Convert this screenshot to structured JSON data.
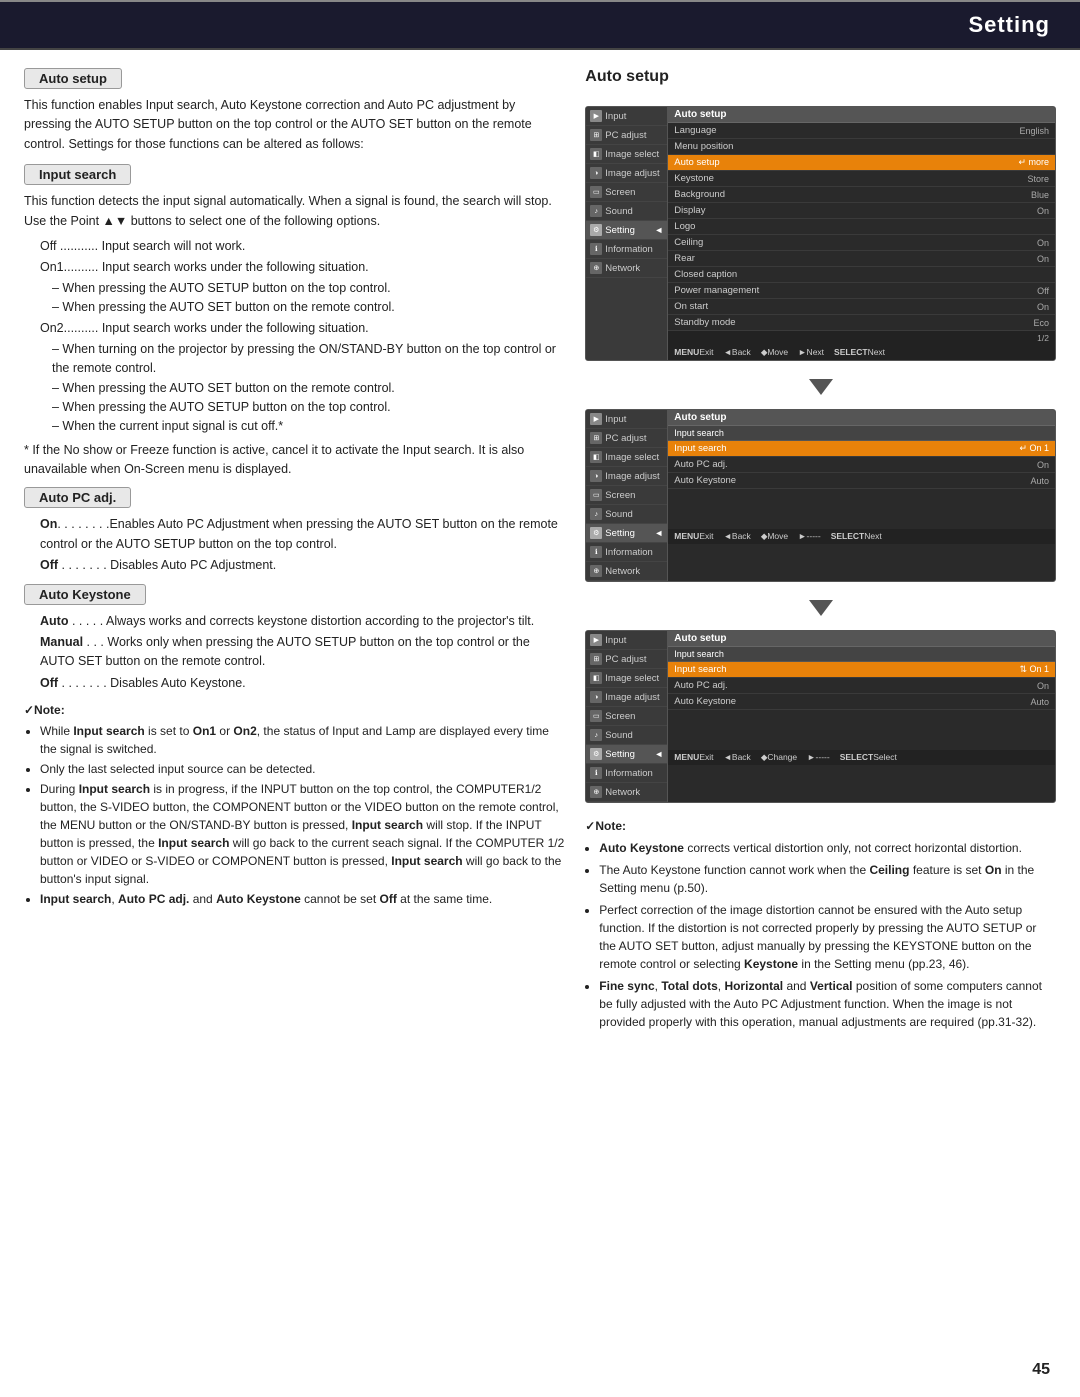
{
  "header": {
    "title": "Setting"
  },
  "page_number": "45",
  "left": {
    "auto_setup_badge": "Auto setup",
    "auto_setup_intro": "This function enables Input search, Auto Keystone correction and Auto PC adjustment by pressing the AUTO SETUP button on the top control or the AUTO SET button on the remote control. Settings for those functions can be altered as follows:",
    "input_search_badge": "Input search",
    "input_search_intro": "This function detects the input signal automatically. When a signal is found, the search will stop. Use the Point ▲▼ buttons to select one of the following options.",
    "off_line": "Off ........... Input search will not work.",
    "on1_line": "On1.......... Input search works under the following situation.",
    "on1_bullets": [
      "– When pressing the AUTO SETUP button on the top control.",
      "– When pressing the AUTO SET button on the remote control."
    ],
    "on2_line": "On2.......... Input search works under the following situation.",
    "on2_bullets": [
      "– When turning on the projector by pressing the ON/STAND-BY button on the top control or the remote control.",
      "– When pressing the AUTO SET button on the remote control.",
      "– When pressing the AUTO SETUP button on the top control.",
      "– When the current input signal is cut off.*"
    ],
    "asterisk_note": "* If the No show or Freeze function is active, cancel it to activate the Input search. It is also unavailable when On-Screen menu is displayed.",
    "auto_pc_adj_badge": "Auto PC adj.",
    "auto_pc_on_line": "On. . . . . . . .Enables Auto PC Adjustment when pressing the AUTO SET button on the remote control or the AUTO SETUP button on the top control.",
    "auto_pc_off_line": "Off . . . . . . . Disables Auto PC Adjustment.",
    "auto_keystone_badge": "Auto Keystone",
    "auto_line": "Auto . . . . . Always works and corrects keystone distortion according to the projector's tilt.",
    "manual_line": "Manual . . . Works only when pressing the AUTO SETUP button on the top control or the AUTO SET button on the remote control.",
    "off_keystone_line": "Off . . . . . . . Disables Auto Keystone.",
    "note_label": "✓Note:",
    "note_bullets": [
      "While Input search is set to On1 or On2, the status of Input and Lamp are displayed every time the signal is switched.",
      "Only the last selected input source can be detected.",
      "During Input search is in progress, if the INPUT button on the top control, the COMPUTER1/2 button, the S-VIDEO button, the COMPONENT button or the VIDEO button on the remote control, the MENU button or the ON/STAND-BY button is pressed, Input search will stop. If the INPUT button is pressed, the Input search will go back to the current seach signal. If the COMPUTER 1/2 button or VIDEO or S-VIDEO or COMPONENT button is pressed, Input search will go back to the button's input signal.",
      "Input search, Auto PC adj. and Auto Keystone cannot be set Off at the same time."
    ]
  },
  "right": {
    "panel1": {
      "title": "Auto setup",
      "sidebar_items": [
        {
          "label": "Input",
          "active": false
        },
        {
          "label": "PC adjust",
          "active": false
        },
        {
          "label": "Image select",
          "active": false
        },
        {
          "label": "Image adjust",
          "active": false
        },
        {
          "label": "Screen",
          "active": false
        },
        {
          "label": "Sound",
          "active": false
        },
        {
          "label": "Setting",
          "active": true
        },
        {
          "label": "Information",
          "active": false
        },
        {
          "label": "Network",
          "active": false
        }
      ],
      "main_header": "Auto setup",
      "rows": [
        {
          "label": "Language",
          "value": "English",
          "highlighted": false
        },
        {
          "label": "Menu position",
          "value": "",
          "highlighted": false
        },
        {
          "label": "Auto setup",
          "value": "↵ more",
          "highlighted": true
        },
        {
          "label": "Keystone",
          "value": "Store",
          "highlighted": false
        },
        {
          "label": "Background",
          "value": "Blue",
          "highlighted": false
        },
        {
          "label": "Display",
          "value": "On",
          "highlighted": false
        },
        {
          "label": "Logo",
          "value": "",
          "highlighted": false
        },
        {
          "label": "Ceiling",
          "value": "On",
          "highlighted": false
        },
        {
          "label": "Rear",
          "value": "On",
          "highlighted": false
        },
        {
          "label": "Closed caption",
          "value": "",
          "highlighted": false
        },
        {
          "label": "Power management",
          "value": "Off",
          "highlighted": false
        },
        {
          "label": "On start",
          "value": "On",
          "highlighted": false
        },
        {
          "label": "Standby mode",
          "value": "Eco",
          "highlighted": false
        }
      ],
      "page_indicator": "1/2",
      "bottom_bar": [
        "MENUExit",
        "◄Back",
        "◆Move",
        "►Next",
        "SELECTNext"
      ]
    },
    "panel2": {
      "title": "Auto setup",
      "sidebar_items": [
        {
          "label": "Input",
          "active": false
        },
        {
          "label": "PC adjust",
          "active": false
        },
        {
          "label": "Image select",
          "active": false
        },
        {
          "label": "Image adjust",
          "active": false
        },
        {
          "label": "Screen",
          "active": false
        },
        {
          "label": "Sound",
          "active": false
        },
        {
          "label": "Setting",
          "active": true
        },
        {
          "label": "Information",
          "active": false
        },
        {
          "label": "Network",
          "active": false
        }
      ],
      "main_header": "Auto setup",
      "sub_header": "Input search",
      "rows": [
        {
          "label": "Input search",
          "value": "↵ On 1",
          "highlighted": true
        },
        {
          "label": "Auto PC adj.",
          "value": "On",
          "highlighted": false
        },
        {
          "label": "Auto Keystone",
          "value": "Auto",
          "highlighted": false
        }
      ],
      "bottom_bar": [
        "MENUExit",
        "◄Back",
        "◆Move",
        "►-----",
        "SELECTNext"
      ]
    },
    "panel3": {
      "title": "Auto setup",
      "sidebar_items": [
        {
          "label": "Input",
          "active": false
        },
        {
          "label": "PC adjust",
          "active": false
        },
        {
          "label": "Image select",
          "active": false
        },
        {
          "label": "Image adjust",
          "active": false
        },
        {
          "label": "Screen",
          "active": false
        },
        {
          "label": "Sound",
          "active": false
        },
        {
          "label": "Setting",
          "active": true
        },
        {
          "label": "Information",
          "active": false
        },
        {
          "label": "Network",
          "active": false
        }
      ],
      "main_header": "Auto setup",
      "sub_header": "Input search",
      "rows": [
        {
          "label": "Input search",
          "value": "⇅ On 1",
          "highlighted": true
        },
        {
          "label": "Auto PC adj.",
          "value": "On",
          "highlighted": false
        },
        {
          "label": "Auto Keystone",
          "value": "Auto",
          "highlighted": false
        }
      ],
      "bottom_bar": [
        "MENUExit",
        "◄Back",
        "◆Change",
        "►-----",
        "SELECTSelect"
      ]
    },
    "notes_title": "✓Note:",
    "notes": [
      "Auto Keystone corrects vertical distortion only, not correct horizontal distortion.",
      "The Auto Keystone function cannot work when the Ceiling feature is set On in the Setting menu (p.50).",
      "Perfect correction of the image distortion cannot be ensured with the Auto setup function. If the distortion is not corrected properly by pressing the AUTO SETUP or the AUTO SET button, adjust manually by pressing the KEYSTONE button on the remote control or selecting Keystone in the Setting menu (pp.23, 46).",
      "Fine sync, Total dots, Horizontal and Vertical position of some computers cannot be fully adjusted with the Auto PC Adjustment function. When the image is not provided properly with this operation, manual adjustments are required (pp.31-32)."
    ]
  }
}
